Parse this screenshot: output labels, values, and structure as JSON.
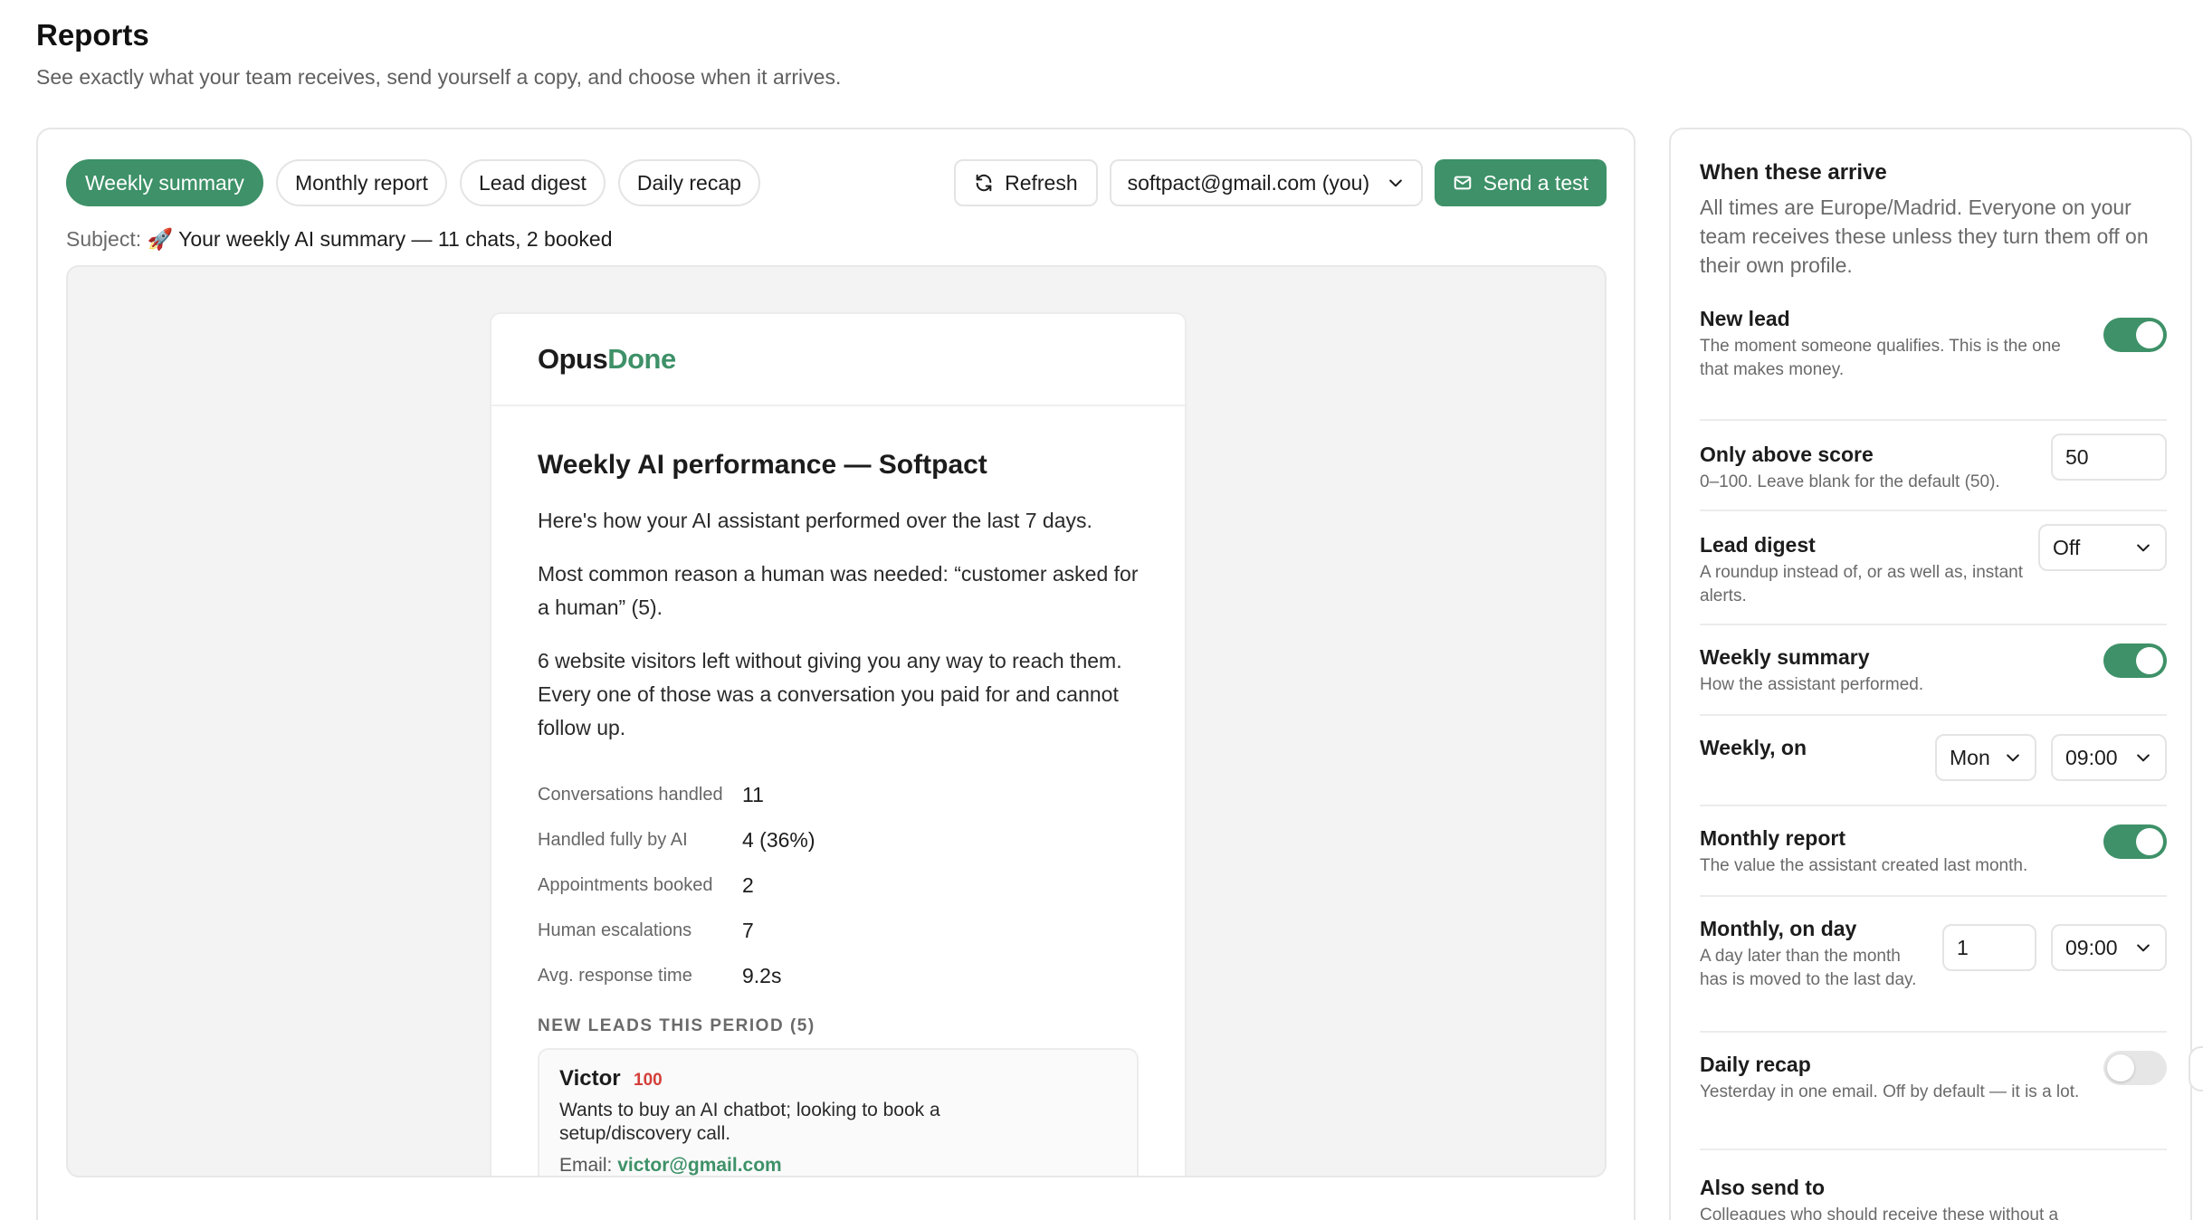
{
  "page": {
    "title": "Reports",
    "subtitle": "See exactly what your team receives, send yourself a copy, and choose when it arrives."
  },
  "tabs": [
    {
      "label": "Weekly summary",
      "active": true
    },
    {
      "label": "Monthly report",
      "active": false
    },
    {
      "label": "Lead digest",
      "active": false
    },
    {
      "label": "Daily recap",
      "active": false
    }
  ],
  "toolbar": {
    "refresh_label": "Refresh",
    "recipient_value": "softpact@gmail.com (you)",
    "send_label": "Send a test"
  },
  "subject": {
    "label": "Subject:",
    "value": "🚀 Your weekly AI summary — 11 chats, 2 booked"
  },
  "email": {
    "brand_part1": "Opus",
    "brand_part2": "Done",
    "title": "Weekly AI performance — Softpact",
    "paragraphs": [
      "Here's how your AI assistant performed over the last 7 days.",
      "Most common reason a human was needed: “customer asked for a human” (5).",
      "6 website visitors left without giving you any way to reach them. Every one of those was a conversation you paid for and cannot follow up."
    ],
    "stats": [
      {
        "label": "Conversations handled",
        "value": "11"
      },
      {
        "label": "Handled fully by AI",
        "value": "4 (36%)"
      },
      {
        "label": "Appointments booked",
        "value": "2"
      },
      {
        "label": "Human escalations",
        "value": "7"
      },
      {
        "label": "Avg. response time",
        "value": "9.2s"
      }
    ],
    "leads_section": "NEW LEADS THIS PERIOD (5)",
    "lead": {
      "name": "Victor",
      "score": "100",
      "description": "Wants to buy an AI chatbot; looking to book a setup/discovery call.",
      "email_label": "Email:",
      "email_value": "victor@gmail.com"
    }
  },
  "side": {
    "title": "When these arrive",
    "description": "All times are Europe/Madrid. Everyone on your team receives these unless they turn them off on their own profile.",
    "new_lead": {
      "label": "New lead",
      "help": "The moment someone qualifies. This is the one that makes money.",
      "enabled": true
    },
    "score": {
      "label": "Only above score",
      "help": "0–100. Leave blank for the default (50).",
      "value": "50"
    },
    "lead_digest": {
      "label": "Lead digest",
      "help": "A roundup instead of, or as well as, instant alerts.",
      "value": "Off"
    },
    "weekly_summary": {
      "label": "Weekly summary",
      "help": "How the assistant performed.",
      "enabled": true
    },
    "weekly_on": {
      "label": "Weekly, on",
      "day": "Mon",
      "time": "09:00"
    },
    "monthly_report": {
      "label": "Monthly report",
      "help": "The value the assistant created last month.",
      "enabled": true
    },
    "monthly_on": {
      "label": "Monthly, on day",
      "help": "A day later than the month has is moved to the last day.",
      "day": "1",
      "time": "09:00"
    },
    "daily_recap": {
      "label": "Daily recap",
      "help": "Yesterday in one email. Off by default — it is a lot.",
      "enabled": false
    },
    "also_send": {
      "label": "Also send to",
      "help": "Colleagues who should receive these without a"
    }
  },
  "colors": {
    "accent": "#3e9168",
    "score_red": "#d43f3a"
  }
}
